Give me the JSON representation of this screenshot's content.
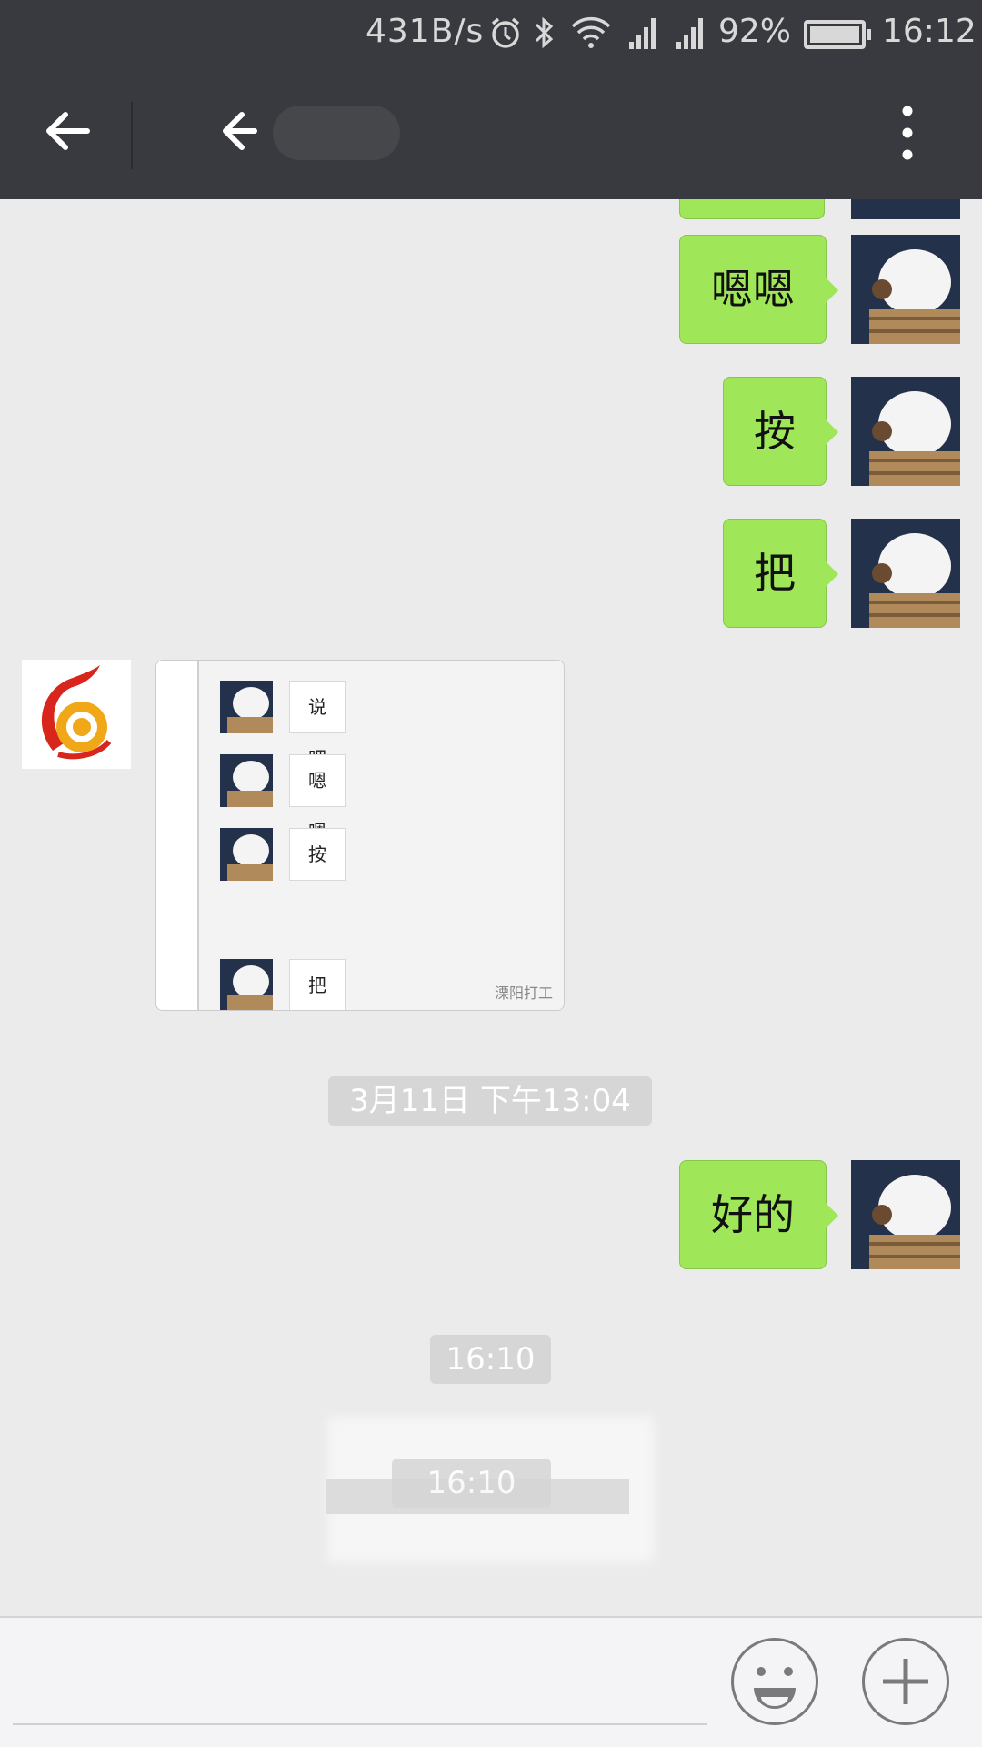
{
  "status_bar": {
    "network_speed": "431B/s",
    "battery_percent": "92%",
    "time": "16:12",
    "icons": [
      "alarm-icon",
      "bluetooth-icon",
      "wifi-icon",
      "signal-icon",
      "signal-icon",
      "battery-icon"
    ]
  },
  "title_bar": {
    "icons": [
      "back-arrow-icon",
      "back-arrow-icon",
      "more-vertical-icon"
    ]
  },
  "messages": [
    {
      "side": "right",
      "text": "嗯嗯"
    },
    {
      "side": "right",
      "text": "按"
    },
    {
      "side": "right",
      "text": "把"
    },
    {
      "side": "left",
      "type": "image",
      "inner_messages": [
        "说吧",
        "嗯嗯",
        "按",
        "把"
      ],
      "watermark": "溧阳打工"
    },
    {
      "side": "right",
      "text": "好的"
    }
  ],
  "timestamps": [
    "3月11日 下午13:04",
    "16:10",
    "16:10"
  ],
  "input_bar": {
    "icons": [
      "emoji-icon",
      "plus-icon"
    ]
  },
  "colors": {
    "header_bg": "#393a3f",
    "chat_bg": "#ebebeb",
    "bubble_me": "#9fe658",
    "input_bg": "#f4f4f6"
  }
}
